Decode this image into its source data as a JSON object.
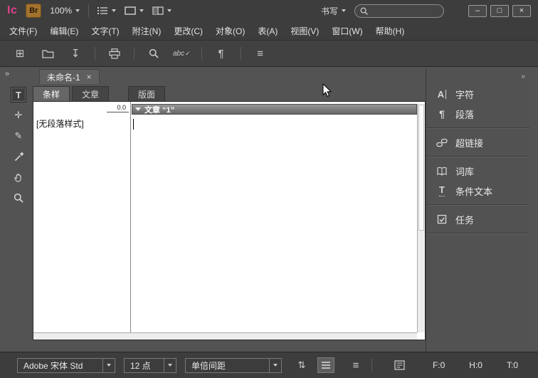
{
  "titlebar": {
    "logo": "Ic",
    "bridge_label": "Br",
    "zoom_value": "100%",
    "workspace": "书写",
    "search": {
      "placeholder": "",
      "value": ""
    }
  },
  "window_controls": {
    "minimize": "–",
    "maximize": "□",
    "close": "×"
  },
  "menubar": {
    "items": [
      "文件(F)",
      "编辑(E)",
      "文字(T)",
      "附注(N)",
      "更改(C)",
      "对象(O)",
      "表(A)",
      "视图(V)",
      "窗口(W)",
      "帮助(H)"
    ]
  },
  "icons": {
    "new_document": "⊞",
    "save": "↧",
    "spell_text": "abc",
    "spell_check": "✓",
    "pilcrow": "¶",
    "panel_menu": "≡",
    "type_tool": "T",
    "position_tool": "✛",
    "note_tool": "✎",
    "collapse_left": "»",
    "collapse_right": "»",
    "character": "A",
    "paragraph": "¶",
    "conditional_text": "T",
    "arrows_updown": "⇅",
    "status_menu": "≡",
    "tab_close": "×"
  },
  "document": {
    "tab_title": "未命名-1",
    "view_tabs": [
      "条样",
      "文章",
      "版面"
    ],
    "ruler_value": "0.0",
    "paragraph_style": "[无段落样式]",
    "story_header": "文章 “1”"
  },
  "dock": {
    "items": [
      {
        "label": "字符"
      },
      {
        "label": "段落"
      },
      {
        "label": "超链接"
      },
      {
        "label": "词库"
      },
      {
        "label": "条件文本"
      },
      {
        "label": "任务"
      }
    ]
  },
  "statusbar": {
    "font_family": "Adobe 宋体 Std",
    "font_size": "12 点",
    "line_spacing": "单倍间距",
    "counters": {
      "f": "F:0",
      "h": "H:0",
      "t": "T:0"
    }
  },
  "colors": {
    "accent_pink": "#e0418c",
    "ui_dark": "#3d3d3d",
    "ui_mid": "#535353",
    "paper": "#ffffff"
  }
}
